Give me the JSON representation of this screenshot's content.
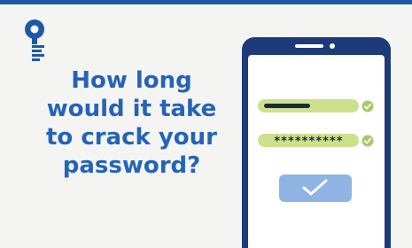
{
  "headline": {
    "line1": "How long",
    "line2": "would it take",
    "line3": "to crack your",
    "line4": "password?"
  },
  "phone": {
    "masked_password": "**********",
    "username_status_icon": "check-circle-icon",
    "password_status_icon": "check-circle-icon",
    "submit_icon": "checkmark-icon"
  },
  "colors": {
    "brand_blue": "#2563b8",
    "top_bar": "#1d57a8",
    "phone_body": "#1c3b78",
    "field_green": "#cde08c",
    "check_green": "#a9c96a",
    "button_blue": "#8fb4e3",
    "background": "#f4f4f2"
  }
}
